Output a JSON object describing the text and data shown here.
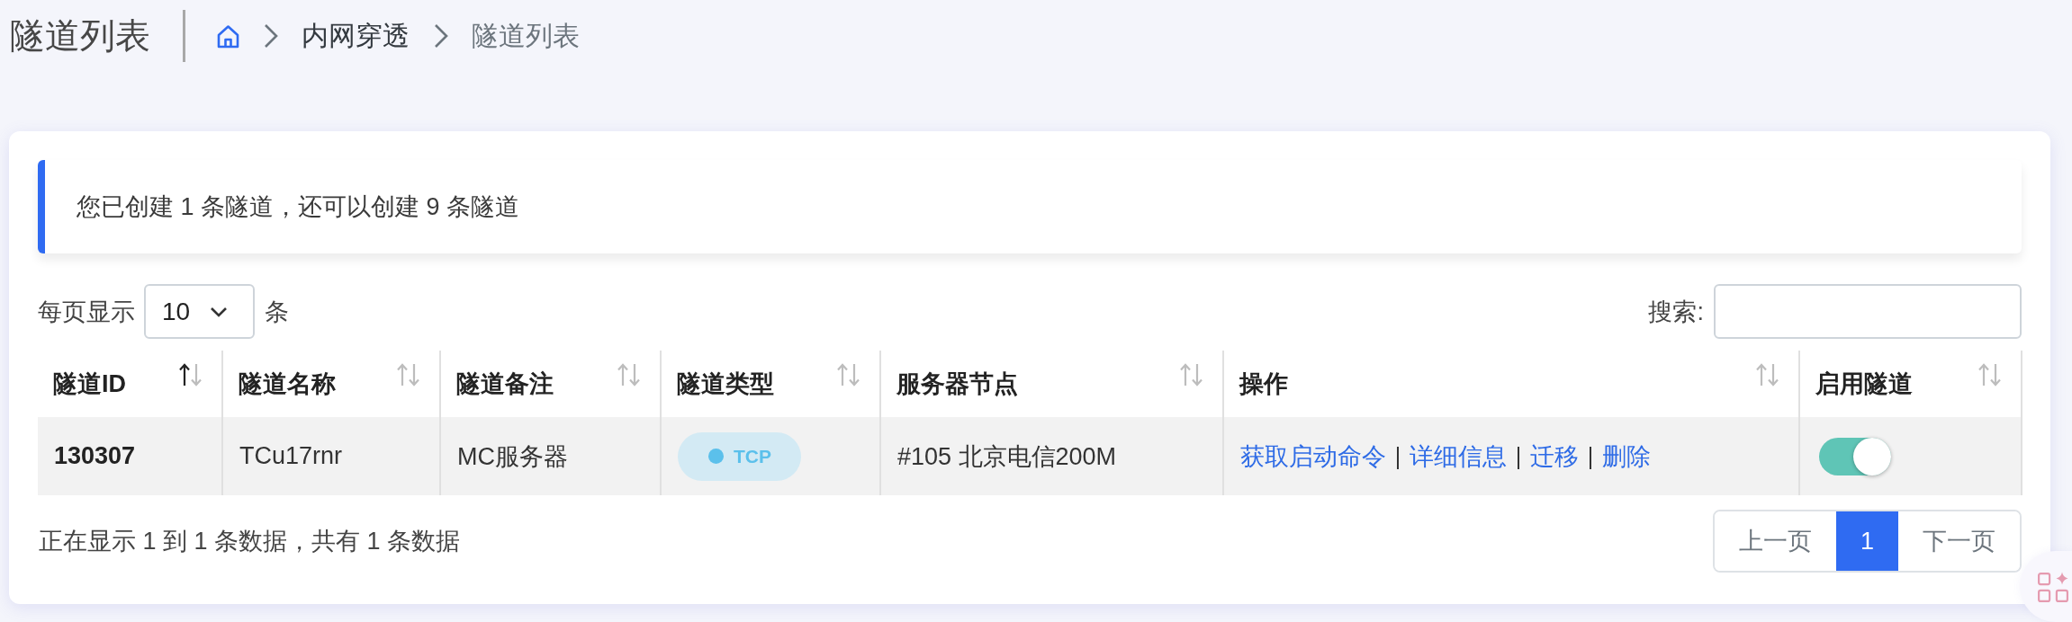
{
  "header": {
    "title": "隧道列表",
    "breadcrumbs": [
      {
        "label": "内网穿透",
        "current": false
      },
      {
        "label": "隧道列表",
        "current": true
      }
    ]
  },
  "notice": {
    "text": "您已创建 1 条隧道，还可以创建 9 条隧道"
  },
  "page_size": {
    "label": "每页显示",
    "value": "10",
    "unit": "条"
  },
  "search": {
    "label": "搜索:"
  },
  "table": {
    "columns": [
      {
        "label": "隧道ID",
        "sorted": true
      },
      {
        "label": "隧道名称",
        "sorted": false
      },
      {
        "label": "隧道备注",
        "sorted": false
      },
      {
        "label": "隧道类型",
        "sorted": false
      },
      {
        "label": "服务器节点",
        "sorted": false
      },
      {
        "label": "操作",
        "sorted": false
      },
      {
        "label": "启用隧道",
        "sorted": false
      }
    ],
    "rows": [
      {
        "id": "130307",
        "name": "TCu17rnr",
        "note": "MC服务器",
        "type": "TCP",
        "node": "#105 北京电信200M",
        "actions": [
          "获取启动命令",
          "详细信息",
          "迁移",
          "删除"
        ],
        "enabled": true
      }
    ]
  },
  "footer": {
    "info": "正在显示 1 到 1 条数据，共有 1 条数据"
  },
  "pagination": {
    "items": [
      {
        "label": "上一页",
        "selected": false,
        "disabled": true
      },
      {
        "label": "1",
        "selected": true,
        "disabled": false
      },
      {
        "label": "下一页",
        "selected": false,
        "disabled": true
      }
    ]
  }
}
